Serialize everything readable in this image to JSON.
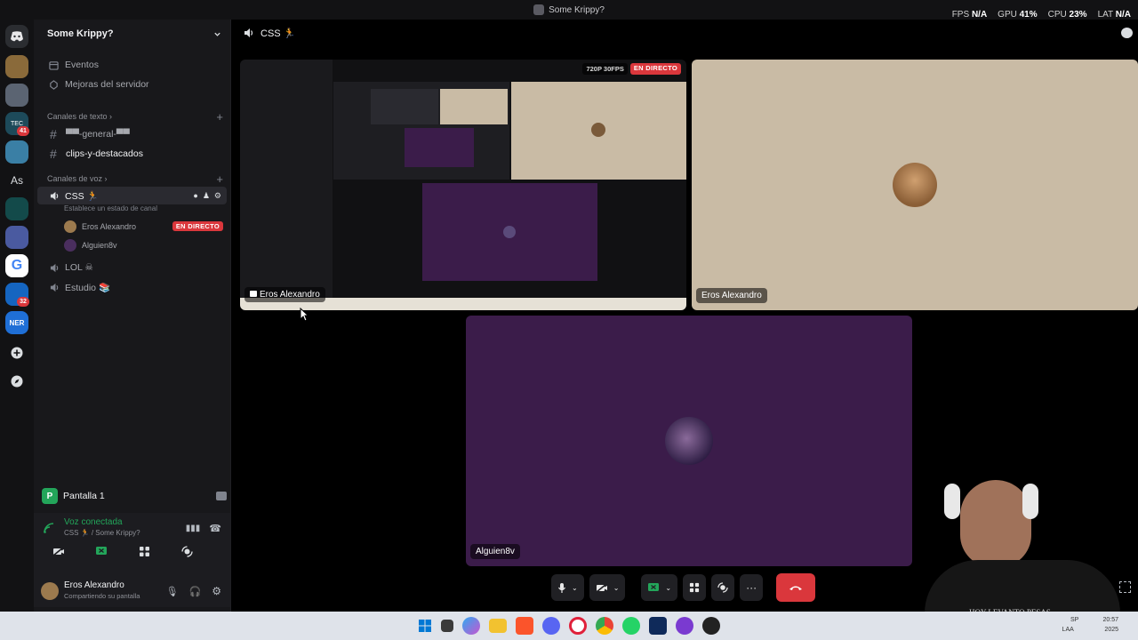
{
  "window": {
    "title": "Some Krippy?"
  },
  "overlay": {
    "fps_label": "FPS",
    "fps_value": "N/A",
    "gpu_label": "GPU",
    "gpu_value": "41%",
    "cpu_label": "CPU",
    "cpu_value": "23%",
    "lat_label": "LAT",
    "lat_value": "N/A"
  },
  "server": {
    "name": "Some Krippy?",
    "nav": [
      {
        "label": "Eventos"
      },
      {
        "label": "Mejoras del servidor"
      }
    ],
    "text_category": "Canales de texto",
    "text_channels": [
      {
        "label": "▀▀-general-▀▀"
      },
      {
        "label": "clips-y-destacados"
      }
    ],
    "voice_category": "Canales de voz",
    "voice_channels": [
      {
        "label": "CSS 🏃",
        "status": "Establece un estado de canal"
      },
      {
        "label": "LOL ☠"
      },
      {
        "label": "Estudio 📚"
      }
    ],
    "members": [
      {
        "name": "Eros Alexandro",
        "badge": "EN DIRECTO"
      },
      {
        "name": "Alguien8v"
      }
    ]
  },
  "rail": {
    "text_server": "As",
    "badges": [
      "41",
      "32"
    ]
  },
  "share_panel": {
    "title": "Pantalla 1"
  },
  "voice_panel": {
    "status": "Voz conectada",
    "location": "CSS 🏃 / Some Krippy?"
  },
  "user_panel": {
    "name": "Eros Alexandro",
    "status": "Compartiendo su pantalla"
  },
  "stage": {
    "channel": "CSS 🏃",
    "tiles": [
      {
        "label": "Eros Alexandro",
        "quality": "720P 30FPS",
        "live": "EN DIRECTO"
      },
      {
        "label": "Eros Alexandro"
      },
      {
        "label": "Alguien8v"
      }
    ]
  },
  "webcam": {
    "shirt_text": "HOY LEVANTO PESAS"
  },
  "tray": {
    "line1": "SP",
    "line2": "LAA",
    "time": "20:57",
    "date": "2025"
  },
  "colors": {
    "live_red": "#da373c",
    "stream_purple": "#3b1c4a",
    "cream_bg": "#c9bba5",
    "connected_green": "#23a55a"
  }
}
